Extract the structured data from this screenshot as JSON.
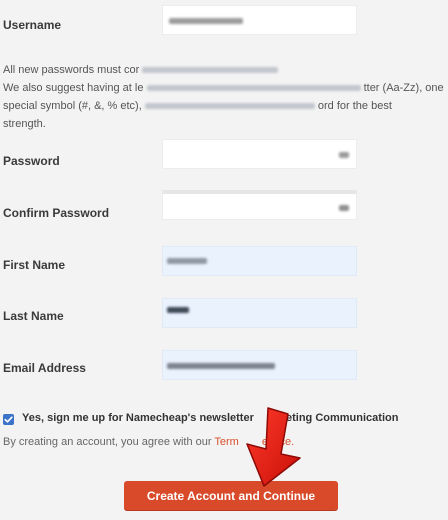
{
  "form": {
    "username_label": "Username",
    "password_note": {
      "line1": "All new passwords must cor",
      "line2_start": "We also suggest having at le",
      "line2_end": "tter (Aa-Zz), one",
      "line3_start": "special symbol (#, &, % etc),",
      "line3_end": "ord for the best",
      "line4": "strength."
    },
    "password_label": "Password",
    "confirm_password_label": "Confirm Password",
    "first_name_label": "First Name",
    "last_name_label": "Last Name",
    "email_label": "Email Address"
  },
  "newsletter": {
    "checked": true,
    "label_start": "Yes, sign me up for Namecheap's newsletter",
    "label_end": "keting Communication"
  },
  "terms": {
    "prefix": "By creating an account, you agree with our",
    "link_start": "Term",
    "link_end": "ervice."
  },
  "submit_label": "Create Account and Continue",
  "colors": {
    "accent": "#d94a2b",
    "checkbox": "#3b73c8",
    "arrow": "#e01b12"
  }
}
